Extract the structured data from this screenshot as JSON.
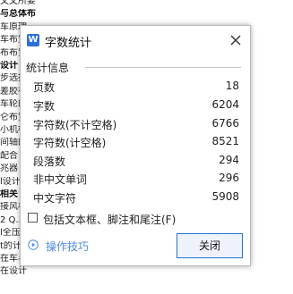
{
  "document_background": {
    "lines": [
      {
        "text": "文文所要解决的问题",
        "bold": false
      },
      {
        "text": "与总体布置",
        "bold": true
      },
      {
        "text": "车原理",
        "bold": false
      },
      {
        "text": "车布置",
        "bold": false
      },
      {
        "text": "布布置",
        "bold": false
      },
      {
        "text": "设计",
        "bold": true
      },
      {
        "text": "步选择",
        "bold": false
      },
      {
        "text": "差胶布",
        "bold": false
      },
      {
        "text": "车轮的",
        "bold": false
      },
      {
        "text": "仑布置",
        "bold": false
      },
      {
        "text": "小机构",
        "bold": false
      },
      {
        "text": "间轴的",
        "bold": false
      },
      {
        "text": "配合",
        "bold": false
      },
      {
        "text": "兆器",
        "bold": false
      },
      {
        "text": "l设计",
        "bold": false
      },
      {
        "text": "相关",
        "bold": true
      },
      {
        "text": "接风机",
        "bold": false
      },
      {
        "text": "2 Q...",
        "bold": false
      },
      {
        "text": "l全压",
        "bold": false
      },
      {
        "text": "t的计",
        "bold": false
      },
      {
        "text": "在车与",
        "bold": false
      },
      {
        "text": "在设计",
        "bold": false
      }
    ]
  },
  "dialog": {
    "title": "字数统计",
    "app_icon_letter": "W",
    "section_title": "统计信息",
    "stats": [
      {
        "label": "页数",
        "value": "18"
      },
      {
        "label": "字数",
        "value": "6204"
      },
      {
        "label": "字符数(不计空格)",
        "value": "6766"
      },
      {
        "label": "字符数(计空格)",
        "value": "8521"
      },
      {
        "label": "段落数",
        "value": "294"
      },
      {
        "label": "非中文单词",
        "value": "296"
      },
      {
        "label": "中文字符",
        "value": "5908"
      }
    ],
    "checkbox_label": "包括文本框、脚注和尾注(F)",
    "checkbox_checked": false,
    "tips_label": "操作技巧",
    "close_button_label": "关闭",
    "colors": {
      "accent": "#2b6fd6",
      "link": "#4a8be0"
    }
  }
}
